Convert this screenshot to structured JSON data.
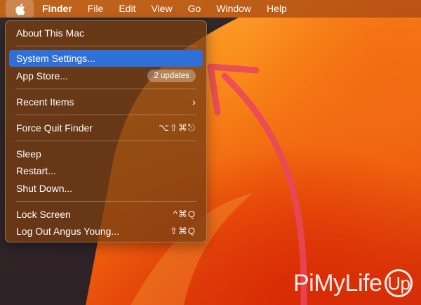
{
  "menubar": {
    "apple_icon": "apple-logo-icon",
    "items": [
      "Finder",
      "File",
      "Edit",
      "View",
      "Go",
      "Window",
      "Help"
    ]
  },
  "apple_menu": {
    "about": "About This Mac",
    "system_settings": "System Settings...",
    "app_store": "App Store...",
    "app_store_badge": "2 updates",
    "recent_items": "Recent Items",
    "force_quit": "Force Quit Finder",
    "force_quit_shortcut": "⌥⇧⌘⎋",
    "sleep": "Sleep",
    "restart": "Restart...",
    "shut_down": "Shut Down...",
    "lock_screen": "Lock Screen",
    "lock_screen_shortcut": "^⌘Q",
    "log_out": "Log Out Angus Young...",
    "log_out_shortcut": "⇧⌘Q"
  },
  "annotation": {
    "arrow_color": "#e8465f",
    "highlight_color": "#2f6fd8"
  },
  "watermark": {
    "main": "PiMyLife",
    "badge": "Up"
  }
}
